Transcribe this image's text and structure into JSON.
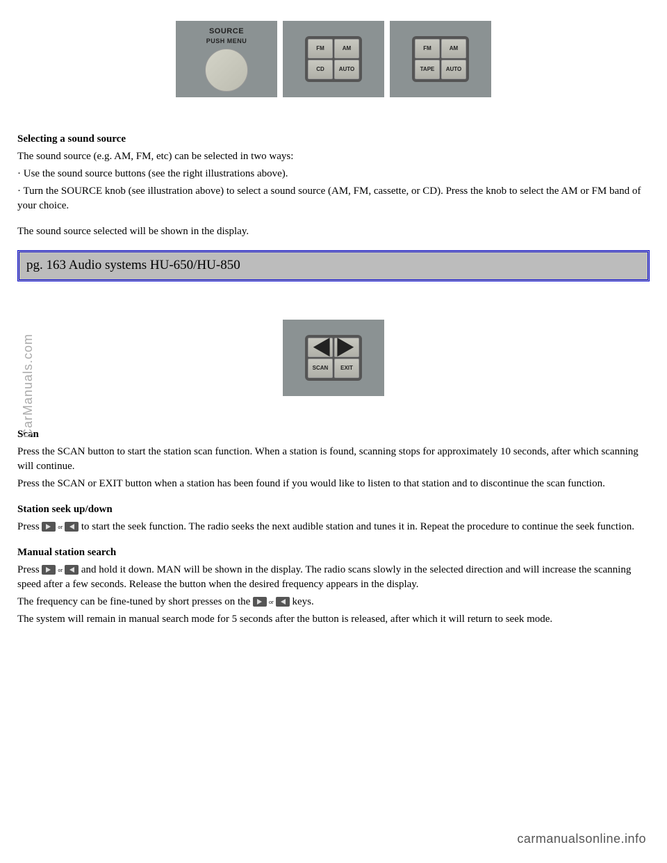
{
  "source_panel": {
    "line1": "SOURCE",
    "line2": "PUSH  MENU"
  },
  "panel2": {
    "tl": "FM",
    "tr": "AM",
    "bl": "CD",
    "br": "AUTO"
  },
  "panel3": {
    "tl": "FM",
    "tr": "AM",
    "bl": "TAPE",
    "br": "AUTO"
  },
  "section1": {
    "heading": "Selecting a sound source",
    "line1": "The sound source (e.g. AM, FM, etc) can be selected in two ways:",
    "bullet1": "· Use the sound source buttons (see the right illustrations above).",
    "bullet2": "· Turn the SOURCE knob (see illustration above) to select a sound source (AM, FM, cassette, or CD). Press the knob to select the AM or FM band of your choice.",
    "line2": "The sound source selected will be shown in the display."
  },
  "banner": "pg. 163 Audio systems HU-650/HU-850",
  "panel4": {
    "bl": "SCAN",
    "br": "EXIT"
  },
  "section2": {
    "heading": "Scan",
    "p1": "Press the SCAN button to start the station scan function. When a station is found, scanning stops for approximately 10 seconds, after which scanning will continue.",
    "p2": "Press the SCAN or EXIT button when a station has been found if you would like to listen to that station and to discontinue the scan function."
  },
  "section3": {
    "heading": "Station seek up/down",
    "p1a": "Press ",
    "p1b": " to start the seek function. The radio seeks the next audible station and tunes it in. Repeat the procedure to continue the seek function."
  },
  "section4": {
    "heading": "Manual station search",
    "p1a": "Press ",
    "p1b": " and hold it down. MAN will be shown in the display. The radio scans slowly in the selected direction and will increase the scanning speed after a few seconds. Release the button when the desired frequency appears in the display.",
    "p2a": "The frequency can be fine-tuned by short presses on the ",
    "p2b": " keys.",
    "p3": "The system will remain in manual search mode for 5 seconds after the button is released, after which it will return to seek mode."
  },
  "or": "or",
  "watermark": "CarManuals.com",
  "footer": "carmanualsonline.info"
}
